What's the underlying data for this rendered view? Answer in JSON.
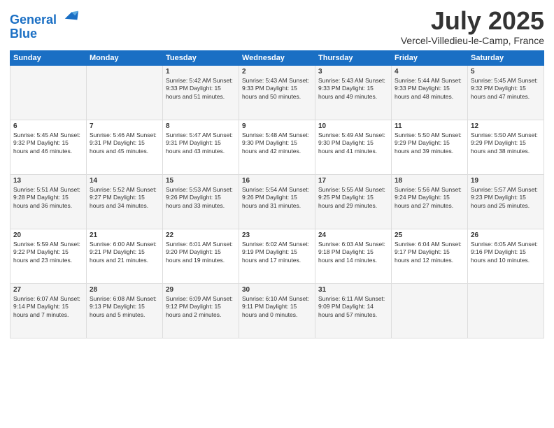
{
  "logo": {
    "line1": "General",
    "line2": "Blue"
  },
  "title": "July 2025",
  "location": "Vercel-Villedieu-le-Camp, France",
  "days_of_week": [
    "Sunday",
    "Monday",
    "Tuesday",
    "Wednesday",
    "Thursday",
    "Friday",
    "Saturday"
  ],
  "weeks": [
    [
      {
        "day": "",
        "info": ""
      },
      {
        "day": "",
        "info": ""
      },
      {
        "day": "1",
        "info": "Sunrise: 5:42 AM\nSunset: 9:33 PM\nDaylight: 15 hours and 51 minutes."
      },
      {
        "day": "2",
        "info": "Sunrise: 5:43 AM\nSunset: 9:33 PM\nDaylight: 15 hours and 50 minutes."
      },
      {
        "day": "3",
        "info": "Sunrise: 5:43 AM\nSunset: 9:33 PM\nDaylight: 15 hours and 49 minutes."
      },
      {
        "day": "4",
        "info": "Sunrise: 5:44 AM\nSunset: 9:33 PM\nDaylight: 15 hours and 48 minutes."
      },
      {
        "day": "5",
        "info": "Sunrise: 5:45 AM\nSunset: 9:32 PM\nDaylight: 15 hours and 47 minutes."
      }
    ],
    [
      {
        "day": "6",
        "info": "Sunrise: 5:45 AM\nSunset: 9:32 PM\nDaylight: 15 hours and 46 minutes."
      },
      {
        "day": "7",
        "info": "Sunrise: 5:46 AM\nSunset: 9:31 PM\nDaylight: 15 hours and 45 minutes."
      },
      {
        "day": "8",
        "info": "Sunrise: 5:47 AM\nSunset: 9:31 PM\nDaylight: 15 hours and 43 minutes."
      },
      {
        "day": "9",
        "info": "Sunrise: 5:48 AM\nSunset: 9:30 PM\nDaylight: 15 hours and 42 minutes."
      },
      {
        "day": "10",
        "info": "Sunrise: 5:49 AM\nSunset: 9:30 PM\nDaylight: 15 hours and 41 minutes."
      },
      {
        "day": "11",
        "info": "Sunrise: 5:50 AM\nSunset: 9:29 PM\nDaylight: 15 hours and 39 minutes."
      },
      {
        "day": "12",
        "info": "Sunrise: 5:50 AM\nSunset: 9:29 PM\nDaylight: 15 hours and 38 minutes."
      }
    ],
    [
      {
        "day": "13",
        "info": "Sunrise: 5:51 AM\nSunset: 9:28 PM\nDaylight: 15 hours and 36 minutes."
      },
      {
        "day": "14",
        "info": "Sunrise: 5:52 AM\nSunset: 9:27 PM\nDaylight: 15 hours and 34 minutes."
      },
      {
        "day": "15",
        "info": "Sunrise: 5:53 AM\nSunset: 9:26 PM\nDaylight: 15 hours and 33 minutes."
      },
      {
        "day": "16",
        "info": "Sunrise: 5:54 AM\nSunset: 9:26 PM\nDaylight: 15 hours and 31 minutes."
      },
      {
        "day": "17",
        "info": "Sunrise: 5:55 AM\nSunset: 9:25 PM\nDaylight: 15 hours and 29 minutes."
      },
      {
        "day": "18",
        "info": "Sunrise: 5:56 AM\nSunset: 9:24 PM\nDaylight: 15 hours and 27 minutes."
      },
      {
        "day": "19",
        "info": "Sunrise: 5:57 AM\nSunset: 9:23 PM\nDaylight: 15 hours and 25 minutes."
      }
    ],
    [
      {
        "day": "20",
        "info": "Sunrise: 5:59 AM\nSunset: 9:22 PM\nDaylight: 15 hours and 23 minutes."
      },
      {
        "day": "21",
        "info": "Sunrise: 6:00 AM\nSunset: 9:21 PM\nDaylight: 15 hours and 21 minutes."
      },
      {
        "day": "22",
        "info": "Sunrise: 6:01 AM\nSunset: 9:20 PM\nDaylight: 15 hours and 19 minutes."
      },
      {
        "day": "23",
        "info": "Sunrise: 6:02 AM\nSunset: 9:19 PM\nDaylight: 15 hours and 17 minutes."
      },
      {
        "day": "24",
        "info": "Sunrise: 6:03 AM\nSunset: 9:18 PM\nDaylight: 15 hours and 14 minutes."
      },
      {
        "day": "25",
        "info": "Sunrise: 6:04 AM\nSunset: 9:17 PM\nDaylight: 15 hours and 12 minutes."
      },
      {
        "day": "26",
        "info": "Sunrise: 6:05 AM\nSunset: 9:16 PM\nDaylight: 15 hours and 10 minutes."
      }
    ],
    [
      {
        "day": "27",
        "info": "Sunrise: 6:07 AM\nSunset: 9:14 PM\nDaylight: 15 hours and 7 minutes."
      },
      {
        "day": "28",
        "info": "Sunrise: 6:08 AM\nSunset: 9:13 PM\nDaylight: 15 hours and 5 minutes."
      },
      {
        "day": "29",
        "info": "Sunrise: 6:09 AM\nSunset: 9:12 PM\nDaylight: 15 hours and 2 minutes."
      },
      {
        "day": "30",
        "info": "Sunrise: 6:10 AM\nSunset: 9:11 PM\nDaylight: 15 hours and 0 minutes."
      },
      {
        "day": "31",
        "info": "Sunrise: 6:11 AM\nSunset: 9:09 PM\nDaylight: 14 hours and 57 minutes."
      },
      {
        "day": "",
        "info": ""
      },
      {
        "day": "",
        "info": ""
      }
    ]
  ]
}
